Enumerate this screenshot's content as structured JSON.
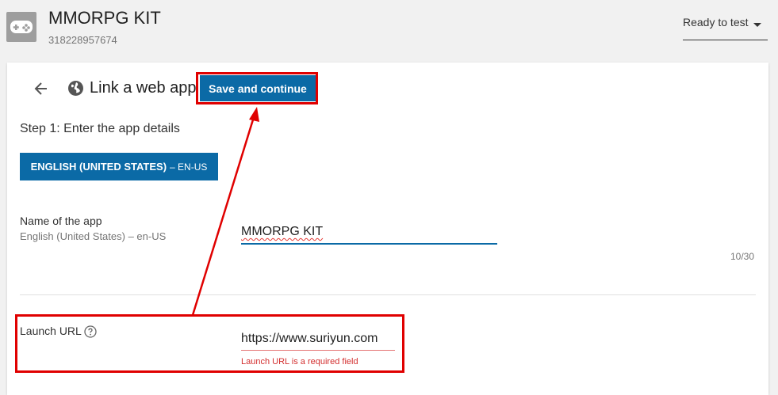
{
  "app": {
    "title": "MMORPG KIT",
    "id": "318228957674",
    "icon": "gamepad-icon",
    "status": "Ready to test"
  },
  "page": {
    "title": "Link a web app",
    "back_icon": "arrow-back-icon",
    "globe_icon": "globe-icon",
    "save_label": "Save and continue",
    "step_label": "Step 1: Enter the app details"
  },
  "language": {
    "name": "ENGLISH (UNITED STATES)",
    "code": "– EN-US"
  },
  "fields": {
    "name": {
      "label": "Name of the app",
      "sublabel": "English (United States) – en-US",
      "value": "MMORPG KIT",
      "count": "10/30"
    },
    "url": {
      "label": "Launch URL",
      "value": "https://www.suriyun.com",
      "error": "Launch URL is a required field",
      "help_icon": "help-circle-icon"
    }
  },
  "colors": {
    "accent": "#0b6aa6",
    "annotation": "#e00000",
    "error": "#d32f2f"
  }
}
